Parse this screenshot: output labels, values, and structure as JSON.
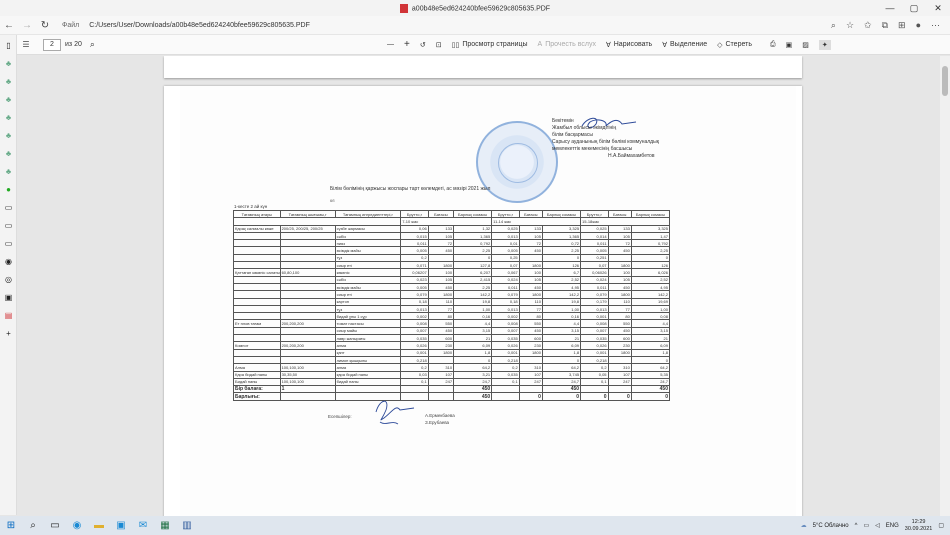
{
  "window": {
    "title": "a00b48e5ed624240bfee59629c805635.PDF",
    "controls": {
      "minimize": "—",
      "restore": "▢",
      "close": "✕"
    }
  },
  "address": {
    "label": "Файл",
    "url": "C:/Users/User/Downloads/a00b48e5ed624240bfee59629c805635.PDF"
  },
  "toolbar": {
    "page_current": "2",
    "page_total": "из 20",
    "zoom_out": "—",
    "zoom_in": "+",
    "page_view": "Просмотр страницы",
    "read_aloud": "Прочесть вслух",
    "draw": "Нарисовать",
    "highlight": "Выделение",
    "erase": "Стереть"
  },
  "document": {
    "stamp_lines": [
      "Бекітемін",
      "Жамбыл облысы әкімдігінің",
      "білім басқармасы",
      "Сарысу ауданының білім бөлімі коммуналдық",
      "мемлекеттік мекемесінің басшысы",
      "Н.А.Баймахамбетов"
    ],
    "title": "Білім бөлімінің қаржысы жоспары тарт көлемдегі, ас мәзірі 2021 жыл",
    "subnote": "6б",
    "left_note": "1-кесте 2 ай күн",
    "headers": [
      "Тағамның атауы",
      "Тағамның шығымы,г",
      "Тағамның ингредиенттері,г",
      "Брутто,г",
      "Бағасы",
      "Барлық сомасы",
      "Брутто,г",
      "Бағасы",
      "Барлық сомасы",
      "Брутто,г",
      "Бағасы",
      "Барлық сомасы"
    ],
    "age_groups": [
      "7-10 жас",
      "11-14 жас",
      "15-18жас"
    ],
    "rows": [
      [
        "Қарақ салмалы көже",
        "200/25, 200/25, 200/25",
        "сүзбе жармасы",
        "0,06",
        "133",
        "1,32",
        "0,025",
        "133",
        "3,325",
        "0,025",
        "133",
        "3,325"
      ],
      [
        "",
        "",
        "сәбіз",
        "0,015",
        "105",
        "1,365",
        "0,013",
        "105",
        "1,365",
        "0,014",
        "105",
        "1,47"
      ],
      [
        "",
        "",
        "пияз",
        "0,011",
        "72",
        "0,792",
        "0,01",
        "72",
        "0,72",
        "0,011",
        "72",
        "0,792"
      ],
      [
        "",
        "",
        "өсімдік майы",
        "0,005",
        "450",
        "2,25",
        "0,005",
        "450",
        "2,25",
        "0,005",
        "450",
        "2,25"
      ],
      [
        "",
        "",
        "тұз",
        "0,2",
        "",
        "0",
        "0,25",
        "",
        "0",
        "0,251",
        "",
        "0"
      ],
      [
        "",
        "",
        "сиыр еті",
        "0,071",
        "1800",
        "127,8",
        "0,07",
        "1800",
        "126",
        "0,07",
        "1800",
        "126"
      ],
      [
        "Қаттаған көкөніс салаты",
        "60,80,100",
        "көкөніс",
        "0,06207",
        "100",
        "6,207",
        "0,067",
        "100",
        "6,7",
        "0,06026",
        "100",
        "6,026"
      ],
      [
        "",
        "",
        "сәбіз",
        "0,023",
        "105",
        "2,415",
        "0,024",
        "105",
        "2,52",
        "0,024",
        "105",
        "2,52"
      ],
      [
        "",
        "",
        "өсімдік майы",
        "0,005",
        "450",
        "2,25",
        "0,011",
        "450",
        "4,95",
        "0,011",
        "450",
        "4,95"
      ],
      [
        "",
        "",
        "сиыр еті",
        "0,079",
        "1800",
        "142,2",
        "0,079",
        "1800",
        "142,2",
        "0,079",
        "1800",
        "142,2"
      ],
      [
        "",
        "",
        "картоп",
        "0,18",
        "110",
        "19,8",
        "0,18",
        "110",
        "19,8",
        "0,179",
        "110",
        "19,69"
      ],
      [
        "",
        "",
        "тұз",
        "0,013",
        "77",
        "1,00",
        "0,013",
        "77",
        "1,00",
        "0,013",
        "77",
        "1,00"
      ],
      [
        "",
        "",
        "бидай ұны 1 сұр",
        "0,002",
        "80",
        "0,16",
        "0,002",
        "80",
        "0,16",
        "0,001",
        "80",
        "0,08"
      ],
      [
        "Ет плов тағам",
        "200,200,200",
        "томат пастасы",
        "0,008",
        "550",
        "4,4",
        "0,008",
        "550",
        "4,4",
        "0,008",
        "550",
        "4,4"
      ],
      [
        "",
        "",
        "сиыр майы",
        "0,007",
        "450",
        "3,15",
        "0,007",
        "450",
        "3,15",
        "0,007",
        "450",
        "3,15"
      ],
      [
        "",
        "",
        "лавр жапырағы",
        "0,035",
        "600",
        "21",
        "0,035",
        "600",
        "21",
        "0,035",
        "600",
        "21"
      ],
      [
        "Компот",
        "200,200,200",
        "алма",
        "0,026",
        "230",
        "6,09",
        "0,026",
        "230",
        "6,09",
        "0,026",
        "230",
        "6,09"
      ],
      [
        "",
        "",
        "қант",
        "0,001",
        "1800",
        "1,8",
        "0,001",
        "1800",
        "1,8",
        "0,001",
        "1800",
        "1,8"
      ],
      [
        "",
        "",
        "лимон қышқылы",
        "0,218",
        "",
        "0",
        "0,218",
        "",
        "0",
        "0,218",
        "",
        "0"
      ],
      [
        "Алма",
        "100,100,100",
        "алма",
        "0,2",
        "310",
        "64,2",
        "0,2",
        "310",
        "64,2",
        "0,2",
        "310",
        "64,2"
      ],
      [
        "Қара бидай наны",
        "30,35,50",
        "қара бидай наны",
        "0,03",
        "107",
        "3,21",
        "0,035",
        "107",
        "3,745",
        "0,05",
        "107",
        "5,35"
      ],
      [
        "Бидай наны",
        "100,100,100",
        "бидай наны",
        "0,1",
        "247",
        "24,7",
        "0,1",
        "247",
        "24,7",
        "0,1",
        "247",
        "24,7"
      ]
    ],
    "total_row": [
      "Бір балаға:",
      "1",
      "",
      "",
      "",
      "450",
      "",
      "",
      "450",
      "",
      "",
      "450"
    ],
    "all_row": [
      "Барлығы:",
      "",
      "",
      "",
      "",
      "450",
      "",
      "0",
      "0",
      "0",
      "0",
      "0"
    ],
    "signers_label": "Есепшілер:",
    "signers": [
      "А.Ермекбаева",
      "З.Ерубаева"
    ]
  },
  "taskbar": {
    "weather": "5°С Облачно",
    "lang": "ENG",
    "time": "12:29",
    "date": "30.09.2021"
  }
}
